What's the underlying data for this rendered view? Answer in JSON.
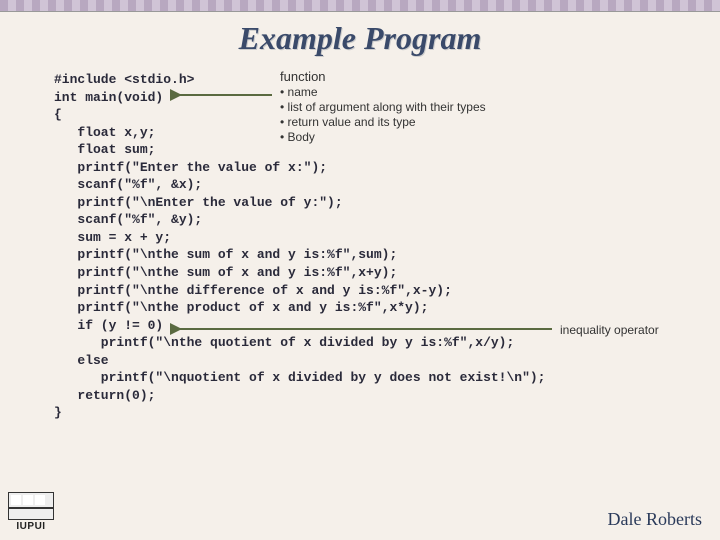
{
  "title": "Example Program",
  "credit": "Dale Roberts",
  "logo_text": "IUPUI",
  "code_lines": [
    "#include <stdio.h>",
    "int main(void)",
    "{",
    "   float x,y;",
    "   float sum;",
    "   printf(\"Enter the value of x:\");",
    "   scanf(\"%f\", &x);",
    "   printf(\"\\nEnter the value of y:\");",
    "   scanf(\"%f\", &y);",
    "   sum = x + y;",
    "   printf(\"\\nthe sum of x and y is:%f\",sum);",
    "   printf(\"\\nthe sum of x and y is:%f\",x+y);",
    "   printf(\"\\nthe difference of x and y is:%f\",x-y);",
    "   printf(\"\\nthe product of x and y is:%f\",x*y);",
    "   if (y != 0)",
    "      printf(\"\\nthe quotient of x divided by y is:%f\",x/y);",
    "   else",
    "      printf(\"\\nquotient of x divided by y does not exist!\\n\");",
    "   return(0);",
    "}"
  ],
  "annotation_function": {
    "head": "function",
    "bullets": [
      "name",
      "list of argument along with their types",
      "return value and its type",
      "Body"
    ]
  },
  "annotation_inequality": "inequality operator"
}
